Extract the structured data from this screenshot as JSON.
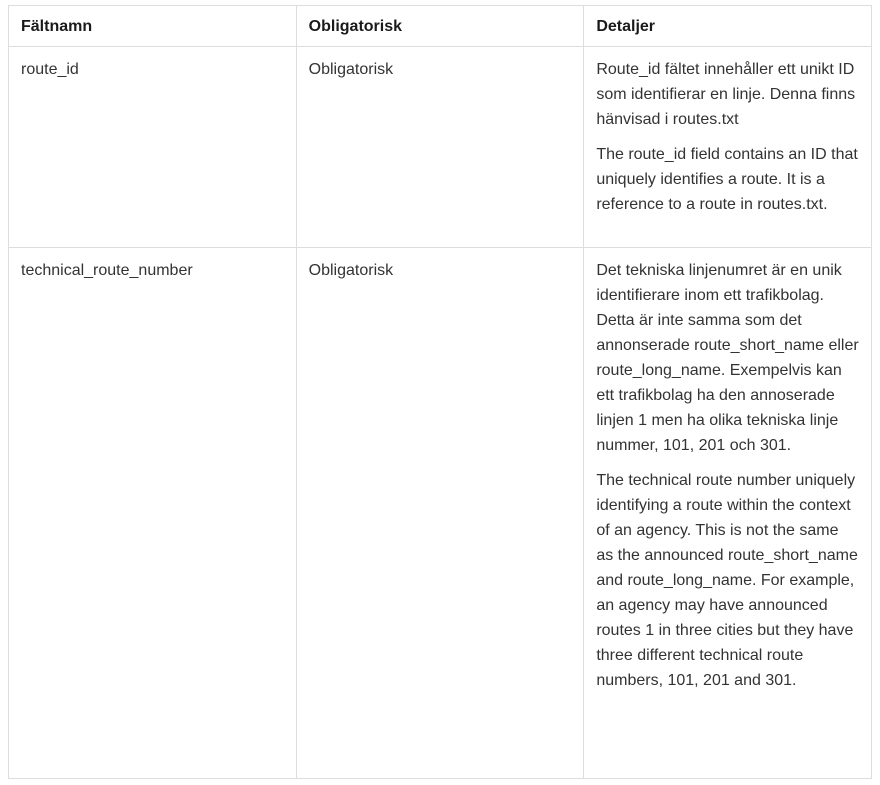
{
  "table": {
    "headers": {
      "field_name": "Fältnamn",
      "required": "Obligatorisk",
      "details": "Detaljer"
    },
    "rows": [
      {
        "field_name": "route_id",
        "required": "Obligatorisk",
        "details_sv": "Route_id fältet innehåller ett unikt ID som identifierar en linje. Denna finns hänvisad i routes.txt",
        "details_en": "The route_id field contains an ID that uniquely identifies a route. It is a reference to a route in routes.txt."
      },
      {
        "field_name": "technical_route_number",
        "required": "Obligatorisk",
        "details_sv": "Det tekniska linjenumret är en unik identifierare inom ett trafikbolag. Detta är inte samma som det annonserade route_short_name eller route_long_name. Exempelvis kan ett trafikbolag ha den annoserade linjen 1 men ha olika tekniska linje nummer, 101, 201 och 301.",
        "details_en": "The technical route number uniquely identifying a route within the context of an agency. This is not the same as the announced route_short_name and route_long_name. For example, an agency may have announced routes 1 in three cities but they have three different technical route numbers, 101, 201 and 301."
      }
    ]
  }
}
